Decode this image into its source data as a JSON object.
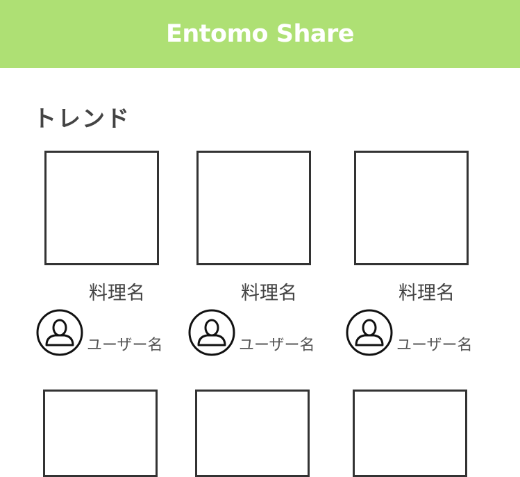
{
  "header": {
    "title": "Entomo Share",
    "background": "#aee074"
  },
  "trend": {
    "title": "トレンド",
    "items": [
      {
        "dish": "料理名",
        "user": "ユーザー名"
      },
      {
        "dish": "料理名",
        "user": "ユーザー名"
      },
      {
        "dish": "料理名",
        "user": "ユーザー名"
      }
    ]
  }
}
